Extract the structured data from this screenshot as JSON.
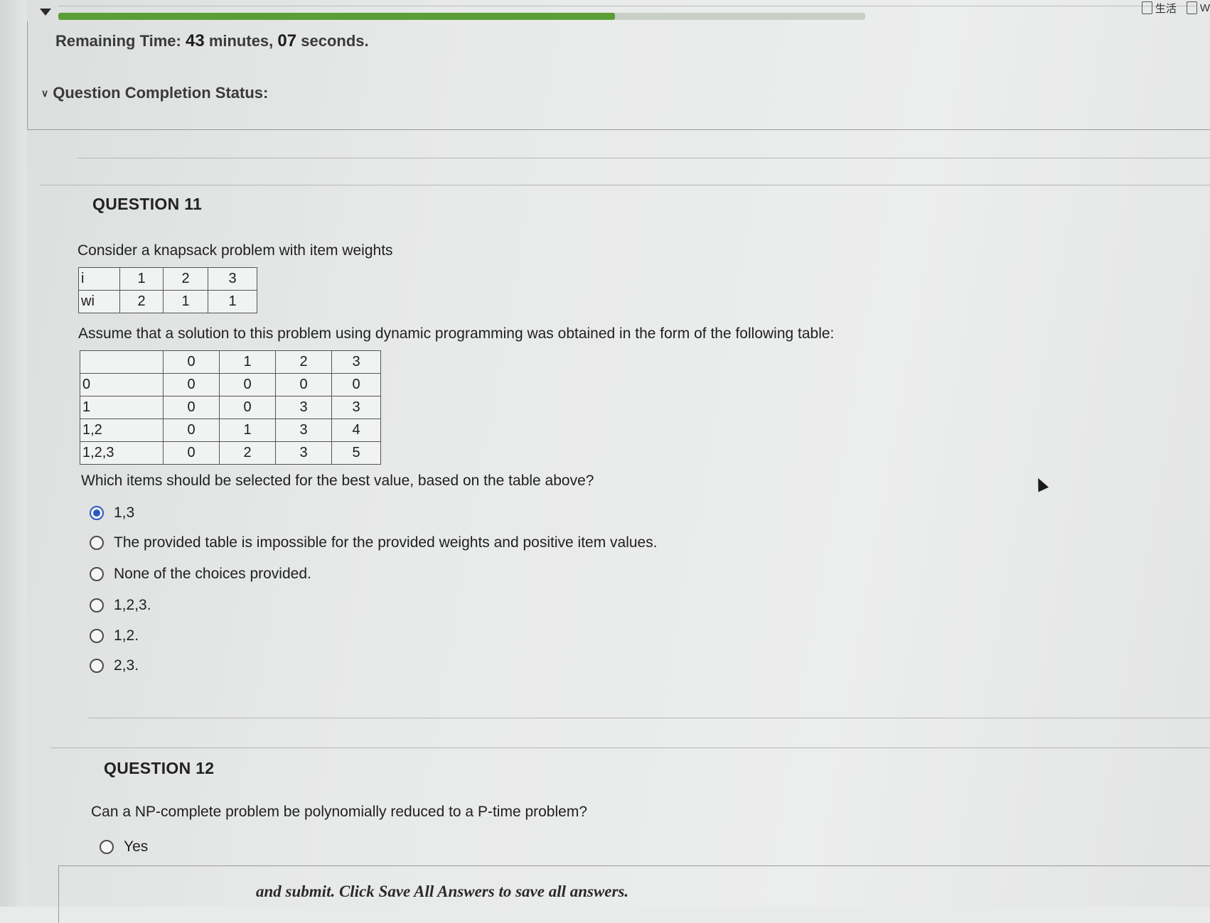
{
  "header": {
    "progress_percent": 69,
    "timer_label": "Remaining Time:",
    "timer_minutes": "43",
    "timer_minutes_unit": "minutes,",
    "timer_seconds": "07",
    "timer_seconds_unit": "seconds.",
    "completion_status_label": "Question Completion Status:"
  },
  "browser_tabs": [
    {
      "label": "生活"
    },
    {
      "label": "W"
    }
  ],
  "question11": {
    "title": "QUESTION 11",
    "intro": "Consider a knapsack problem with item weights",
    "weights_table": {
      "rows": [
        [
          "i",
          "1",
          "2",
          "3"
        ],
        [
          "wi",
          "2",
          "1",
          "1"
        ]
      ]
    },
    "assume_text": "Assume that a solution to this problem using dynamic programming was obtained in the form of the following table:",
    "dp_table": {
      "header": [
        "",
        "0",
        "1",
        "2",
        "3"
      ],
      "rows": [
        [
          "0",
          "0",
          "0",
          "0",
          "0"
        ],
        [
          "1",
          "0",
          "0",
          "3",
          "3"
        ],
        [
          "1,2",
          "0",
          "1",
          "3",
          "4"
        ],
        [
          "1,2,3",
          "0",
          "2",
          "3",
          "5"
        ]
      ]
    },
    "prompt": "Which items should be selected for the best value, based on the table above?",
    "options": [
      {
        "label": "1,3",
        "selected": true
      },
      {
        "label": "The provided table is impossible for the provided weights and positive item values.",
        "selected": false
      },
      {
        "label": "None of the choices provided.",
        "selected": false
      },
      {
        "label": "1,2,3.",
        "selected": false
      },
      {
        "label": "1,2.",
        "selected": false
      },
      {
        "label": "2,3.",
        "selected": false
      }
    ]
  },
  "question12": {
    "title": "QUESTION 12",
    "prompt": "Can a NP-complete problem be polynomially reduced to a P-time problem?",
    "options": [
      {
        "label": "Yes",
        "selected": false
      }
    ]
  },
  "footer": {
    "save_text": "and submit. Click Save All Answers to save all answers."
  }
}
